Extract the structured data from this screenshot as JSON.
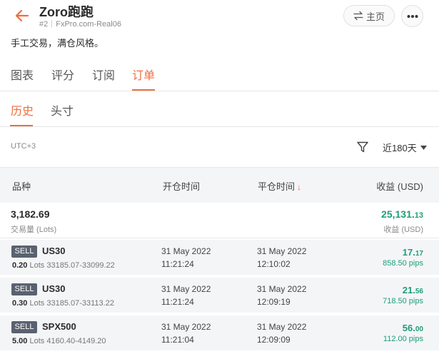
{
  "header": {
    "title": "Zoro跑跑",
    "account_no": "#2",
    "server": "FxPro.com-Real06",
    "home_label": "主页"
  },
  "description": "手工交易，满仓风格。",
  "tabs": [
    "图表",
    "评分",
    "订阅",
    "订单"
  ],
  "active_tab": "订单",
  "subtabs": [
    "历史",
    "头寸"
  ],
  "active_subtab": "历史",
  "filter": {
    "timezone": "UTC+3",
    "range": "近180天"
  },
  "table": {
    "headers": {
      "symbol": "品种",
      "open_time": "开仓时间",
      "close_time": "平仓时间",
      "profit": "收益 (USD)"
    },
    "summary": {
      "volume": "3,182.69",
      "volume_label": "交易量 (Lots)",
      "profit_main": "25,131.",
      "profit_cents": "13",
      "profit_label": "收益 (USD)"
    },
    "rows": [
      {
        "side": "SELL",
        "symbol": "US30",
        "lots": "0.20",
        "lots_unit": "Lots",
        "price_range": "33185.07-33099.22",
        "open_date": "31 May 2022",
        "open_time": "11:21:24",
        "close_date": "31 May 2022",
        "close_time": "12:10:02",
        "profit_main": "17.",
        "profit_cents": "17",
        "pips": "858.50 pips"
      },
      {
        "side": "SELL",
        "symbol": "US30",
        "lots": "0.30",
        "lots_unit": "Lots",
        "price_range": "33185.07-33113.22",
        "open_date": "31 May 2022",
        "open_time": "11:21:24",
        "close_date": "31 May 2022",
        "close_time": "12:09:19",
        "profit_main": "21.",
        "profit_cents": "56",
        "pips": "718.50 pips"
      },
      {
        "side": "SELL",
        "symbol": "SPX500",
        "lots": "5.00",
        "lots_unit": "Lots",
        "price_range": "4160.40-4149.20",
        "open_date": "31 May 2022",
        "open_time": "11:21:04",
        "close_date": "31 May 2022",
        "close_time": "12:09:09",
        "profit_main": "56.",
        "profit_cents": "00",
        "pips": "112.00 pips"
      }
    ]
  },
  "icons": {
    "back": "arrow-left-icon",
    "home": "swap-icon",
    "more": "more-dots-icon",
    "filter": "filter-icon",
    "dropdown": "caret-down-icon",
    "sort": "arrow-down-icon"
  },
  "colors": {
    "accent": "#f26d3d",
    "profit": "#1e9e77",
    "badge": "#5a6270"
  }
}
